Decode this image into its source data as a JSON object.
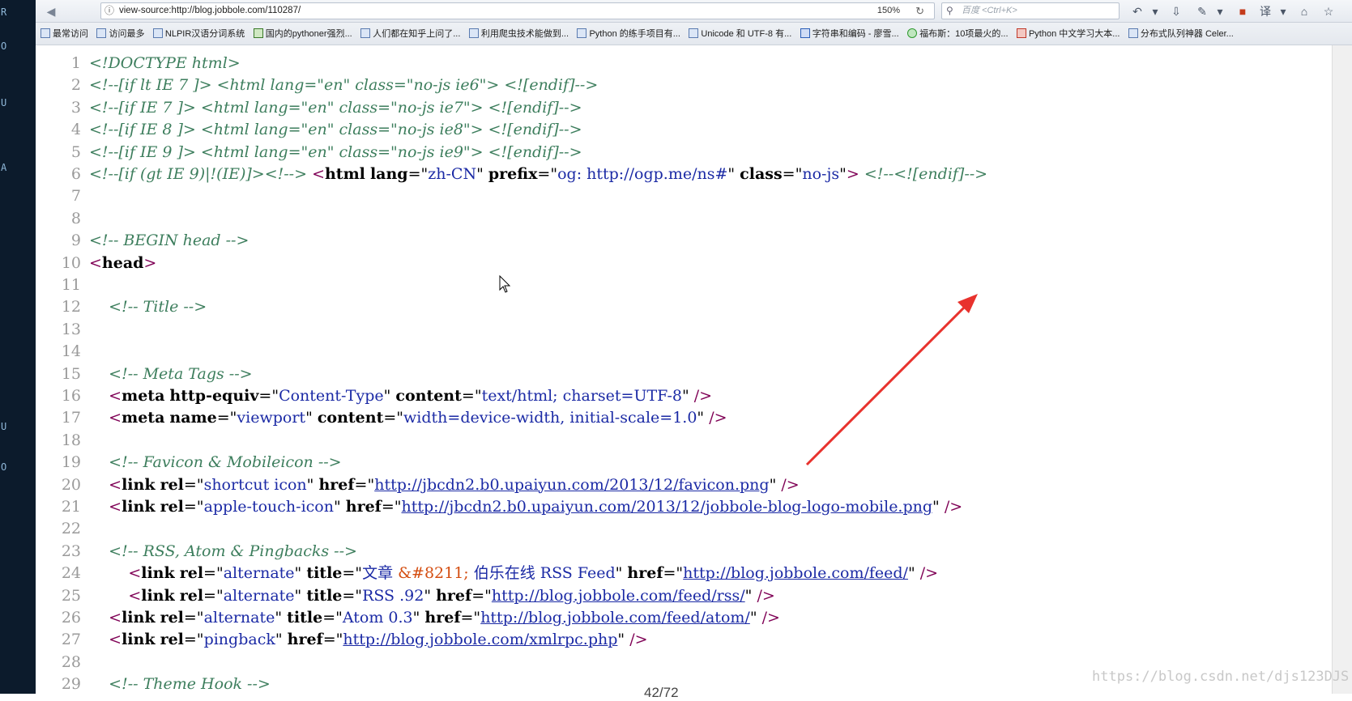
{
  "browser": {
    "url": "view-source:http://blog.jobbole.com/110287/",
    "zoom": "150%",
    "search_placeholder": "百度 <Ctrl+K>"
  },
  "bookmarks": [
    "最常访问",
    "访问最多",
    "NLPIR汉语分词系统",
    "国内的pythoner强烈...",
    "人们都在知乎上问了...",
    "利用爬虫技术能做到...",
    "Python 的练手项目有...",
    "Unicode 和 UTF-8 有...",
    "字符串和编码 - 廖雪...",
    "福布斯：10项最火的...",
    "Python 中文学习大本...",
    "分布式队列神器 Celer..."
  ],
  "source_lines": [
    {
      "n": "1",
      "segs": [
        [
          "pi",
          "<!DOCTYPE html>"
        ]
      ]
    },
    {
      "n": "2",
      "segs": [
        [
          "c",
          "<!--[if lt IE 7 ]> <html lang=\"en\" class=\"no-js ie6\"> <![endif]-->"
        ]
      ]
    },
    {
      "n": "3",
      "segs": [
        [
          "c",
          "<!--[if IE 7 ]> <html lang=\"en\" class=\"no-js ie7\"> <![endif]-->"
        ]
      ]
    },
    {
      "n": "4",
      "segs": [
        [
          "c",
          "<!--[if IE 8 ]> <html lang=\"en\" class=\"no-js ie8\"> <![endif]-->"
        ]
      ]
    },
    {
      "n": "5",
      "segs": [
        [
          "c",
          "<!--[if IE 9 ]> <html lang=\"en\" class=\"no-js ie9\"> <![endif]-->"
        ]
      ]
    },
    {
      "n": "6",
      "segs": [
        [
          "c",
          "<!--[if (gt IE 9)|!(IE)]><!-->"
        ],
        [
          "t",
          " "
        ],
        [
          "tag",
          "<"
        ],
        [
          "tn",
          "html"
        ],
        [
          "t",
          " "
        ],
        [
          "an",
          "lang"
        ],
        [
          "t",
          "=\""
        ],
        [
          "av",
          "zh-CN"
        ],
        [
          "t",
          "\" "
        ],
        [
          "an",
          "prefix"
        ],
        [
          "t",
          "=\""
        ],
        [
          "av",
          "og: http://ogp.me/ns#"
        ],
        [
          "t",
          "\" "
        ],
        [
          "an",
          "class"
        ],
        [
          "t",
          "=\""
        ],
        [
          "av",
          "no-js"
        ],
        [
          "t",
          "\""
        ],
        [
          "tag",
          ">"
        ],
        [
          "t",
          " "
        ],
        [
          "c",
          "<!--<![endif]-->"
        ]
      ]
    },
    {
      "n": "7",
      "segs": []
    },
    {
      "n": "8",
      "segs": []
    },
    {
      "n": "9",
      "segs": [
        [
          "c",
          "<!-- BEGIN head -->"
        ]
      ]
    },
    {
      "n": "10",
      "segs": [
        [
          "tag",
          "<"
        ],
        [
          "tn",
          "head"
        ],
        [
          "tag",
          ">"
        ]
      ]
    },
    {
      "n": "11",
      "segs": []
    },
    {
      "n": "12",
      "segs": [
        [
          "t",
          "    "
        ],
        [
          "c",
          "<!-- Title -->"
        ]
      ]
    },
    {
      "n": "13",
      "segs": []
    },
    {
      "n": "14",
      "segs": []
    },
    {
      "n": "15",
      "segs": [
        [
          "t",
          "    "
        ],
        [
          "c",
          "<!-- Meta Tags -->"
        ]
      ]
    },
    {
      "n": "16",
      "segs": [
        [
          "t",
          "    "
        ],
        [
          "tag",
          "<"
        ],
        [
          "tn",
          "meta"
        ],
        [
          "t",
          " "
        ],
        [
          "an",
          "http-equiv"
        ],
        [
          "t",
          "=\""
        ],
        [
          "av",
          "Content-Type"
        ],
        [
          "t",
          "\" "
        ],
        [
          "an",
          "content"
        ],
        [
          "t",
          "=\""
        ],
        [
          "av",
          "text/html; charset=UTF-8"
        ],
        [
          "t",
          "\" "
        ],
        [
          "tag",
          "/>"
        ]
      ]
    },
    {
      "n": "17",
      "segs": [
        [
          "t",
          "    "
        ],
        [
          "tag",
          "<"
        ],
        [
          "tn",
          "meta"
        ],
        [
          "t",
          " "
        ],
        [
          "an",
          "name"
        ],
        [
          "t",
          "=\""
        ],
        [
          "av",
          "viewport"
        ],
        [
          "t",
          "\" "
        ],
        [
          "an",
          "content"
        ],
        [
          "t",
          "=\""
        ],
        [
          "av",
          "width=device-width, initial-scale=1.0"
        ],
        [
          "t",
          "\" "
        ],
        [
          "tag",
          "/>"
        ]
      ]
    },
    {
      "n": "18",
      "segs": []
    },
    {
      "n": "19",
      "segs": [
        [
          "t",
          "    "
        ],
        [
          "c",
          "<!-- Favicon & Mobileicon -->"
        ]
      ]
    },
    {
      "n": "20",
      "segs": [
        [
          "t",
          "    "
        ],
        [
          "tag",
          "<"
        ],
        [
          "tn",
          "link"
        ],
        [
          "t",
          " "
        ],
        [
          "an",
          "rel"
        ],
        [
          "t",
          "=\""
        ],
        [
          "av",
          "shortcut icon"
        ],
        [
          "t",
          "\" "
        ],
        [
          "an",
          "href"
        ],
        [
          "t",
          "=\""
        ],
        [
          "lk",
          "http://jbcdn2.b0.upaiyun.com/2013/12/favicon.png"
        ],
        [
          "t",
          "\" "
        ],
        [
          "tag",
          "/>"
        ]
      ]
    },
    {
      "n": "21",
      "segs": [
        [
          "t",
          "    "
        ],
        [
          "tag",
          "<"
        ],
        [
          "tn",
          "link"
        ],
        [
          "t",
          " "
        ],
        [
          "an",
          "rel"
        ],
        [
          "t",
          "=\""
        ],
        [
          "av",
          "apple-touch-icon"
        ],
        [
          "t",
          "\" "
        ],
        [
          "an",
          "href"
        ],
        [
          "t",
          "=\""
        ],
        [
          "lk",
          "http://jbcdn2.b0.upaiyun.com/2013/12/jobbole-blog-logo-mobile.png"
        ],
        [
          "t",
          "\" "
        ],
        [
          "tag",
          "/>"
        ]
      ]
    },
    {
      "n": "22",
      "segs": []
    },
    {
      "n": "23",
      "segs": [
        [
          "t",
          "    "
        ],
        [
          "c",
          "<!-- RSS, Atom & Pingbacks -->"
        ]
      ]
    },
    {
      "n": "24",
      "segs": [
        [
          "t",
          "        "
        ],
        [
          "tag",
          "<"
        ],
        [
          "tn",
          "link"
        ],
        [
          "t",
          " "
        ],
        [
          "an",
          "rel"
        ],
        [
          "t",
          "=\""
        ],
        [
          "av",
          "alternate"
        ],
        [
          "t",
          "\" "
        ],
        [
          "an",
          "title"
        ],
        [
          "t",
          "=\""
        ],
        [
          "av",
          "文章 "
        ],
        [
          "ent",
          "&#8211;"
        ],
        [
          "av",
          " 伯乐在线 RSS Feed"
        ],
        [
          "t",
          "\" "
        ],
        [
          "an",
          "href"
        ],
        [
          "t",
          "=\""
        ],
        [
          "lk",
          "http://blog.jobbole.com/feed/"
        ],
        [
          "t",
          "\" "
        ],
        [
          "tag",
          "/>"
        ]
      ]
    },
    {
      "n": "25",
      "segs": [
        [
          "t",
          "        "
        ],
        [
          "tag",
          "<"
        ],
        [
          "tn",
          "link"
        ],
        [
          "t",
          " "
        ],
        [
          "an",
          "rel"
        ],
        [
          "t",
          "=\""
        ],
        [
          "av",
          "alternate"
        ],
        [
          "t",
          "\" "
        ],
        [
          "an",
          "title"
        ],
        [
          "t",
          "=\""
        ],
        [
          "av",
          "RSS .92"
        ],
        [
          "t",
          "\" "
        ],
        [
          "an",
          "href"
        ],
        [
          "t",
          "=\""
        ],
        [
          "lk",
          "http://blog.jobbole.com/feed/rss/"
        ],
        [
          "t",
          "\" "
        ],
        [
          "tag",
          "/>"
        ]
      ]
    },
    {
      "n": "26",
      "segs": [
        [
          "t",
          "    "
        ],
        [
          "tag",
          "<"
        ],
        [
          "tn",
          "link"
        ],
        [
          "t",
          " "
        ],
        [
          "an",
          "rel"
        ],
        [
          "t",
          "=\""
        ],
        [
          "av",
          "alternate"
        ],
        [
          "t",
          "\" "
        ],
        [
          "an",
          "title"
        ],
        [
          "t",
          "=\""
        ],
        [
          "av",
          "Atom 0.3"
        ],
        [
          "t",
          "\" "
        ],
        [
          "an",
          "href"
        ],
        [
          "t",
          "=\""
        ],
        [
          "lk",
          "http://blog.jobbole.com/feed/atom/"
        ],
        [
          "t",
          "\" "
        ],
        [
          "tag",
          "/>"
        ]
      ]
    },
    {
      "n": "27",
      "segs": [
        [
          "t",
          "    "
        ],
        [
          "tag",
          "<"
        ],
        [
          "tn",
          "link"
        ],
        [
          "t",
          " "
        ],
        [
          "an",
          "rel"
        ],
        [
          "t",
          "=\""
        ],
        [
          "av",
          "pingback"
        ],
        [
          "t",
          "\" "
        ],
        [
          "an",
          "href"
        ],
        [
          "t",
          "=\""
        ],
        [
          "lk",
          "http://blog.jobbole.com/xmlrpc.php"
        ],
        [
          "t",
          "\" "
        ],
        [
          "tag",
          "/>"
        ]
      ]
    },
    {
      "n": "28",
      "segs": []
    },
    {
      "n": "29",
      "segs": [
        [
          "t",
          "    "
        ],
        [
          "c",
          "<!-- Theme Hook -->"
        ]
      ]
    }
  ],
  "pager": "42/72",
  "watermark": "https://blog.csdn.net/djs123DJS",
  "annotation_color": "#e8322d"
}
